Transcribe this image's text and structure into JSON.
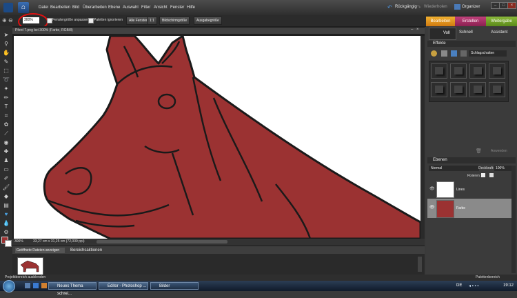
{
  "menubar": {
    "items": [
      "Datei",
      "Bearbeiten",
      "Bild",
      "Überarbeiten",
      "Ebene",
      "Auswahl",
      "Filter",
      "Ansicht",
      "Fenster",
      "Hilfe"
    ],
    "undo_label": "Rückgängig",
    "redo_label": "Wiederholen",
    "organizer_label": "Organizer"
  },
  "options": {
    "zoom_value": "300%",
    "resize_windows_label": "Fenstergröße anpassen",
    "ignore_palettes_label": "Paletten ignorieren",
    "all_windows_label": "Alle Fenster",
    "btn_1to1": "1:1",
    "btn_fit_screen": "Bildschirmgröße",
    "btn_print_size": "Ausgabegröße"
  },
  "mode_tabs": [
    "Bearbeiten",
    "Erstellen",
    "Weitergabe"
  ],
  "edit_modes": [
    "Voll",
    "Schnell",
    "Assistent"
  ],
  "document": {
    "title": "Pferd 7.png bei 300% (Farbe, RGB/8)",
    "status_zoom": "300%",
    "status_info": "33,27 cm x 31,25 cm (72,009 ppi)"
  },
  "effects": {
    "title": "Effekte",
    "dropdown_value": "Schlagschatten",
    "apply_label": "Anwenden"
  },
  "layers": {
    "title": "Ebenen",
    "blend_mode": "Normal",
    "opacity_label": "Deckkraft:",
    "opacity_value": "100%",
    "lock_label": "Fixieren:",
    "items": [
      {
        "name": "Lines"
      },
      {
        "name": "Farbe"
      }
    ]
  },
  "bin": {
    "dropdown_value": "Geöffnete Dateien anzeigen",
    "actions_label": "Bereichsaktionen",
    "hide_label": "Projektbereich ausblenden",
    "palette_label": "Palettenbereich"
  },
  "taskbar": {
    "tasks": [
      "Neues Thema schrei...",
      "Editor - Photoshop ...",
      "Bilder"
    ],
    "lang": "DE",
    "time": "19:12"
  },
  "colors": {
    "horse": "#9b3232",
    "accent_tab": "#e8a020",
    "tab2": "#b0326a",
    "tab3": "#7aa32a"
  }
}
